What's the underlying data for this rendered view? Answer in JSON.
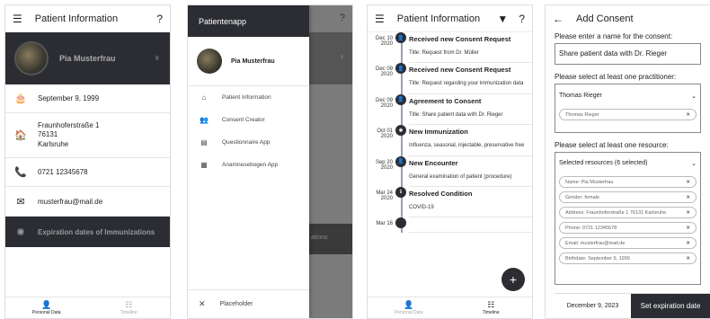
{
  "screen1": {
    "title": "Patient Information",
    "help": "?",
    "patient_name": "Pia Musterfrau",
    "gender_symbol": "♀",
    "birthdate": "September 9, 1999",
    "address": [
      "Fraunhoferstraße 1",
      "76131",
      "Karlsruhe"
    ],
    "phone": "0721 12345678",
    "email": "musterfrau@mail.de",
    "immunization_link": "Expiration dates of Immunizations",
    "nav": [
      {
        "label": "Personal Data"
      },
      {
        "label": "Timeline"
      }
    ]
  },
  "screen2": {
    "drawer_title": "Patientenapp",
    "help": "?",
    "patient_name": "Pia Musterfrau",
    "items": [
      {
        "label": "Patient Information"
      },
      {
        "label": "Consent Creator"
      },
      {
        "label": "Questionnaire App"
      },
      {
        "label": "Anamnesebogen App"
      }
    ],
    "placeholder": "Placeholder",
    "partial_text": "ations"
  },
  "screen3": {
    "title": "Patient Information",
    "help": "?",
    "entries": [
      {
        "date": "Dec 10\n2020",
        "title": "Received new Consent Request",
        "desc": "Title: Request from Dr. Müller"
      },
      {
        "date": "Dec 09\n2020",
        "title": "Received new Consent Request",
        "desc": "Title: Request regarding your immunization data"
      },
      {
        "date": "Dec 09\n2020",
        "title": "Agreement to Consent",
        "desc": "Title: Share patient data with Dr. Rieger"
      },
      {
        "date": "Oct 01\n2020",
        "title": "New Immunization",
        "desc": "Influenza, seasonal, injectable, preservative free"
      },
      {
        "date": "Sep 20\n2020",
        "title": "New Encounter",
        "desc": "General examination of patient (procedure)"
      },
      {
        "date": "Mar 24\n2020",
        "title": "Resolved Condition",
        "desc": "COVID-19"
      },
      {
        "date": "Mar 16",
        "title": "",
        "desc": ""
      }
    ],
    "nav": [
      {
        "label": "Personal Data"
      },
      {
        "label": "Timeline"
      }
    ]
  },
  "screen4": {
    "title": "Add Consent",
    "name_label": "Please enter a name for the consent:",
    "name_value": "Share patient data with Dr. Rieger",
    "practitioner_label": "Please select at least one practitioner:",
    "practitioner_selected": "Thomas Rieger",
    "practitioner_chip": "Thomas Rieger",
    "resource_label": "Please select at least one resource:",
    "resource_summary": "Selected resources (6 selected)",
    "resources": [
      "Name: Pia Musterfrau",
      "Gender: female",
      "Address: Fraunhoferstraße 1 76131 Karlsruhe",
      "Phone: 0721 12345678",
      "Email: musterfrau@mail.de",
      "Birthdate: September 9, 1999"
    ],
    "date": "December 9, 2023",
    "set_expiration": "Set expiration date"
  }
}
